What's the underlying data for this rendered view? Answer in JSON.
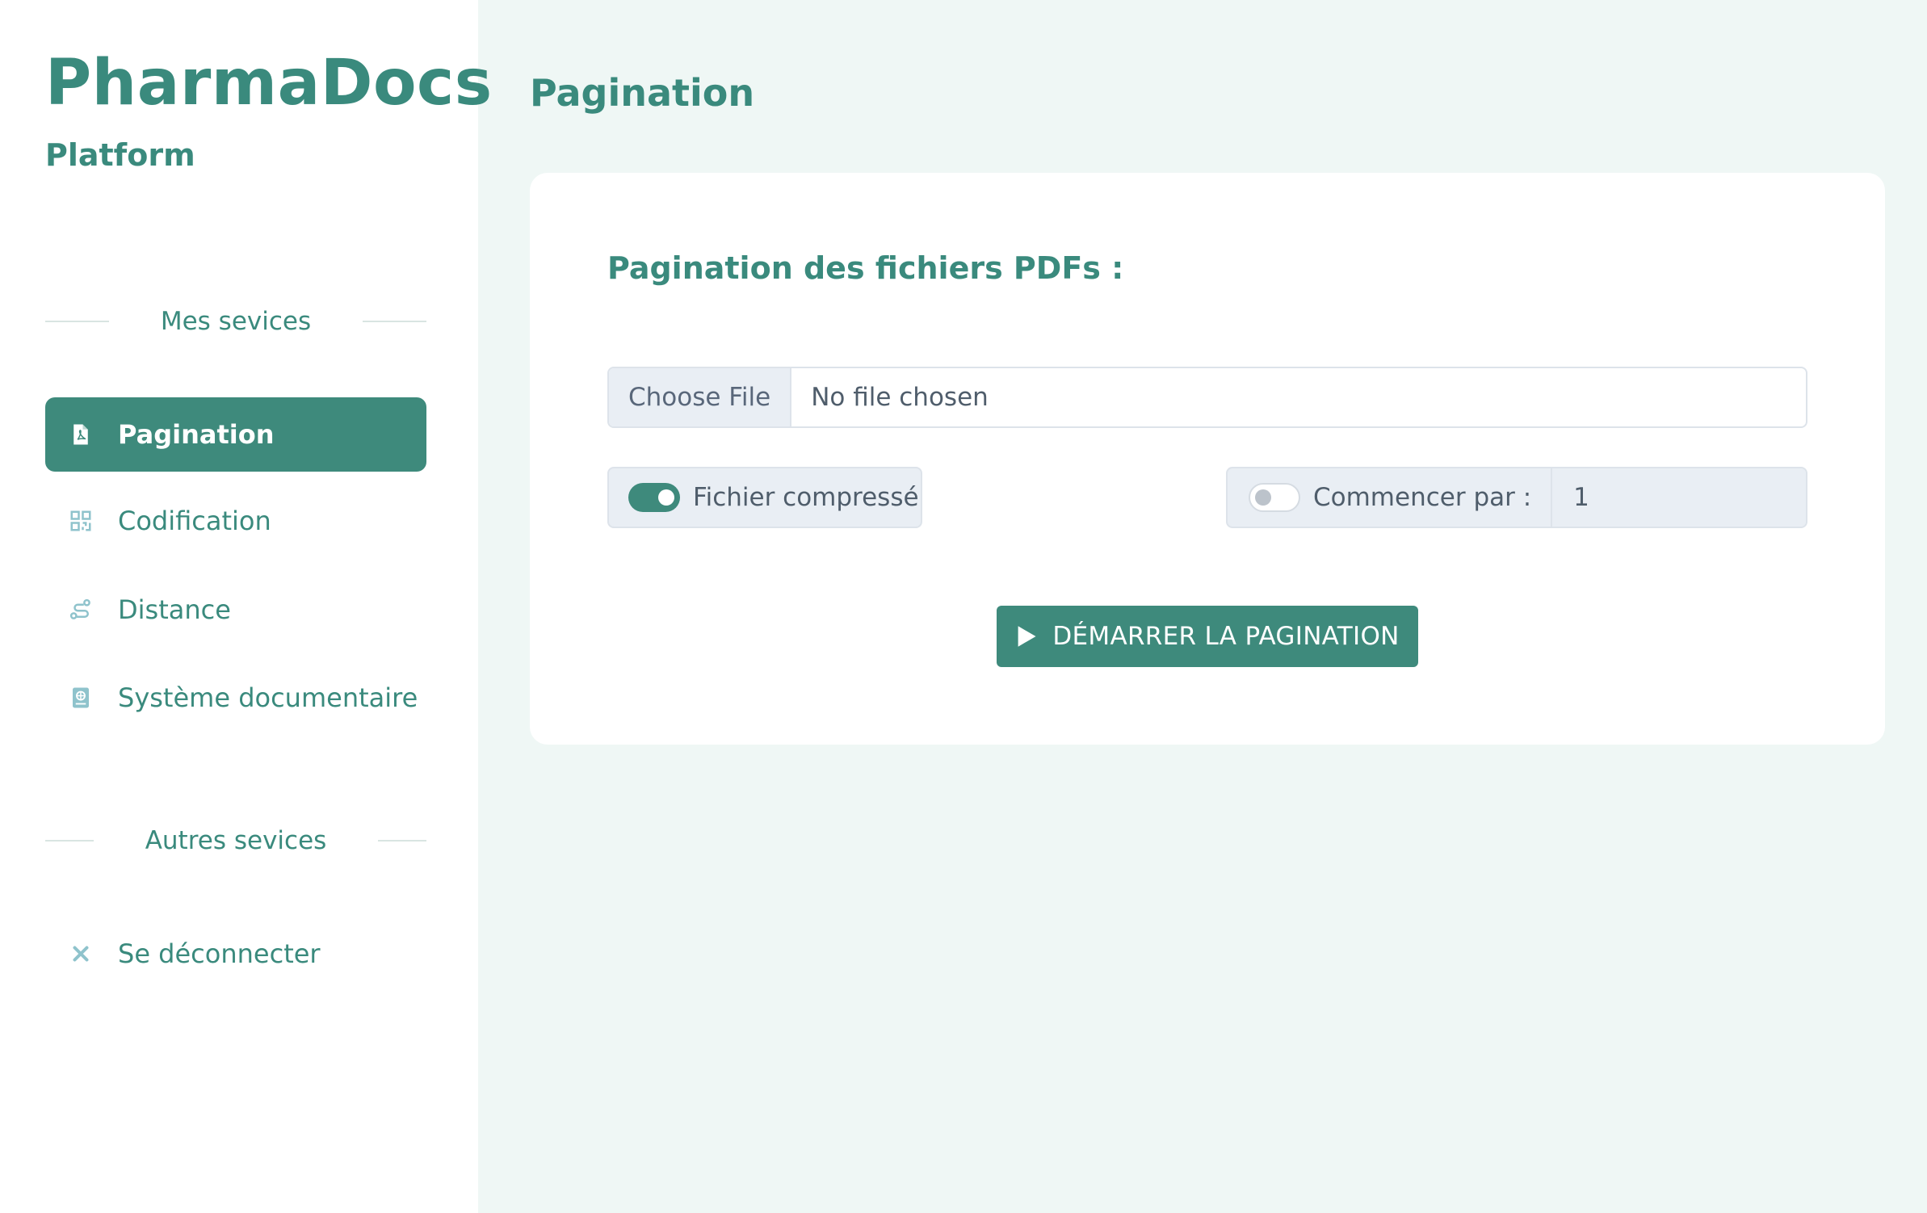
{
  "brand": {
    "title": "PharmaDocs",
    "subtitle": "Platform"
  },
  "sidebar": {
    "section1_heading": "Mes sevices",
    "items": [
      {
        "label": "Pagination",
        "icon": "pdf-file-icon",
        "active": true
      },
      {
        "label": "Codification",
        "icon": "qr-code-icon",
        "active": false
      },
      {
        "label": "Distance",
        "icon": "route-icon",
        "active": false
      },
      {
        "label": "Système documentaire",
        "icon": "book-icon",
        "active": false
      }
    ],
    "section2_heading": "Autres sevices",
    "logout_label": "Se déconnecter"
  },
  "main": {
    "page_title": "Pagination",
    "card_title": "Pagination des fichiers PDFs :",
    "file_input": {
      "button_label": "Choose File",
      "status": "No file chosen"
    },
    "compressed_toggle": {
      "label": "Fichier compressé",
      "on": true
    },
    "start_toggle": {
      "label": "Commencer par :",
      "on": false,
      "value": "1"
    },
    "start_button_label": "DÉMARRER LA PAGINATION"
  },
  "colors": {
    "accent": "#3e8a7c",
    "sidebar_bg": "#ffffff",
    "main_bg": "#eff7f5",
    "icon_muted": "#8fc3cc"
  }
}
